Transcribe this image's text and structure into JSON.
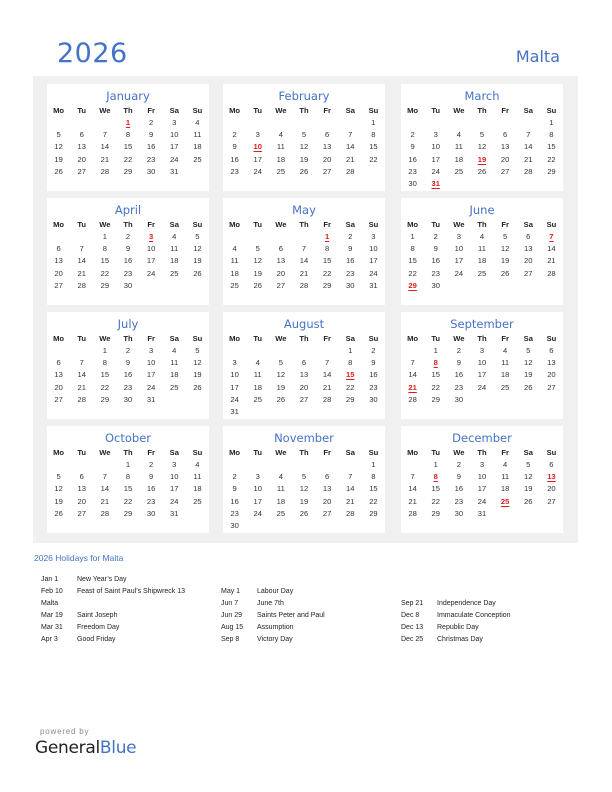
{
  "header": {
    "year": "2026",
    "country": "Malta"
  },
  "weekdays": [
    "Mo",
    "Tu",
    "We",
    "Th",
    "Fr",
    "Sa",
    "Su"
  ],
  "months": [
    {
      "name": "January",
      "start": 3,
      "days": 31,
      "holidays": [
        1
      ]
    },
    {
      "name": "February",
      "start": 6,
      "days": 28,
      "holidays": [
        10
      ]
    },
    {
      "name": "March",
      "start": 6,
      "days": 31,
      "holidays": [
        19,
        31
      ]
    },
    {
      "name": "April",
      "start": 2,
      "days": 30,
      "holidays": [
        3
      ]
    },
    {
      "name": "May",
      "start": 4,
      "days": 31,
      "holidays": [
        1
      ]
    },
    {
      "name": "June",
      "start": 0,
      "days": 30,
      "holidays": [
        7,
        29
      ]
    },
    {
      "name": "July",
      "start": 2,
      "days": 31,
      "holidays": []
    },
    {
      "name": "August",
      "start": 5,
      "days": 31,
      "holidays": [
        15
      ]
    },
    {
      "name": "September",
      "start": 1,
      "days": 30,
      "holidays": [
        8,
        21
      ]
    },
    {
      "name": "October",
      "start": 3,
      "days": 31,
      "holidays": []
    },
    {
      "name": "November",
      "start": 6,
      "days": 30,
      "holidays": []
    },
    {
      "name": "December",
      "start": 1,
      "days": 31,
      "holidays": [
        8,
        13,
        25
      ]
    }
  ],
  "holidays_section": {
    "title": "2026 Holidays for Malta",
    "columns": [
      [
        {
          "date": "Jan 1",
          "name": "New Year’s Day"
        },
        {
          "date": "Feb 10",
          "name": "Feast of Saint Paul’s Shipwreck 13"
        },
        {
          "date": "Malta",
          "name": ""
        },
        {
          "date": "Mar 19",
          "name": "Saint Joseph"
        },
        {
          "date": "Mar 31",
          "name": "Freedom Day"
        },
        {
          "date": "Apr 3",
          "name": "Good Friday"
        }
      ],
      [
        {
          "date": "May 1",
          "name": "Labour Day"
        },
        {
          "date": "Jun 7",
          "name": "June 7th"
        },
        {
          "date": "Jun 29",
          "name": "Saints Peter and Paul"
        },
        {
          "date": "Aug 15",
          "name": "Assumption"
        },
        {
          "date": "Sep 8",
          "name": "Victory Day"
        }
      ],
      [
        {
          "date": "Sep 21",
          "name": "Independence Day"
        },
        {
          "date": "Dec 8",
          "name": "Immaculate Conception"
        },
        {
          "date": "Dec 13",
          "name": "Republic Day"
        },
        {
          "date": "Dec 25",
          "name": "Christmas Day"
        }
      ]
    ]
  },
  "footer": {
    "powered_by": "powered by",
    "brand_part1": "General",
    "brand_part2": "Blue"
  },
  "colors": {
    "accent": "#4472c4",
    "holiday": "#e0191f",
    "panel_bg": "#f0f0f0"
  }
}
